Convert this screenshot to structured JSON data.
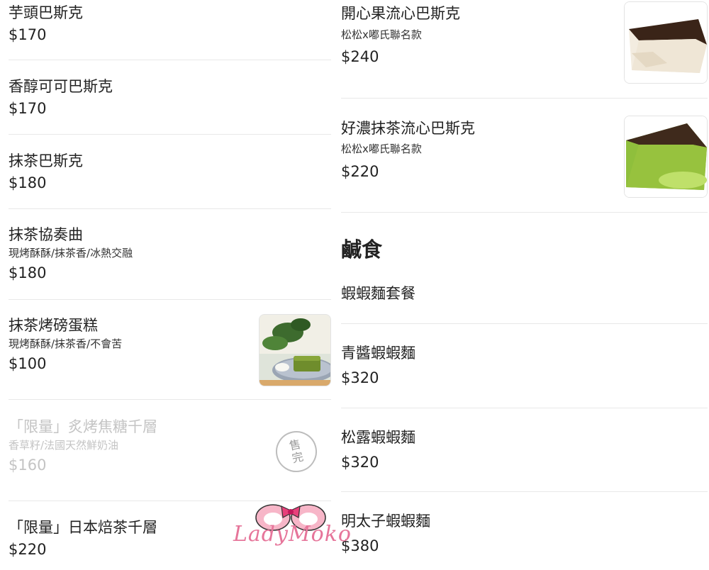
{
  "left_items": [
    {
      "name": "芋頭巴斯克",
      "price": "$170"
    },
    {
      "name": "香醇可可巴斯克",
      "price": "$170"
    },
    {
      "name": "抹茶巴斯克",
      "price": "$180"
    },
    {
      "name": "抹茶協奏曲",
      "description": "現烤酥酥/抹茶香/冰熱交融",
      "price": "$180"
    },
    {
      "name": "抹茶烤磅蛋糕",
      "description": "現烤酥酥/抹茶香/不會苦",
      "price": "$100",
      "image_icon": "matcha-pound-cake-photo"
    },
    {
      "name": "「限量」炙烤焦糖千層",
      "description": "香草籽/法國天然鮮奶油",
      "price": "$160",
      "status_badge": [
        "售",
        "完"
      ]
    },
    {
      "name": "「限量」日本焙茶千層",
      "price": "$220"
    }
  ],
  "right_items": [
    {
      "name": "開心果流心巴斯克",
      "description": "松松x嘟氏聯名款",
      "price": "$240",
      "image_icon": "pistachio-basque-cake-photo"
    },
    {
      "name": "好濃抹茶流心巴斯克",
      "description": "松松x嘟氏聯名款",
      "price": "$220",
      "image_icon": "matcha-basque-cake-photo"
    }
  ],
  "savory_section": {
    "title": "鹹食",
    "items": [
      {
        "name": "蝦蝦麵套餐"
      },
      {
        "name": "青醬蝦蝦麵",
        "price": "$320"
      },
      {
        "name": "松露蝦蝦麵",
        "price": "$320"
      },
      {
        "name": "明太子蝦蝦麵",
        "price": "$380"
      }
    ]
  },
  "watermark": {
    "text": "LadyMoko",
    "color": "#e6759a"
  },
  "colors": {
    "text": "#222222",
    "soldout_text": "#c4c4c4",
    "divider": "#e8e8e8",
    "badge": "#9a9a9a"
  }
}
